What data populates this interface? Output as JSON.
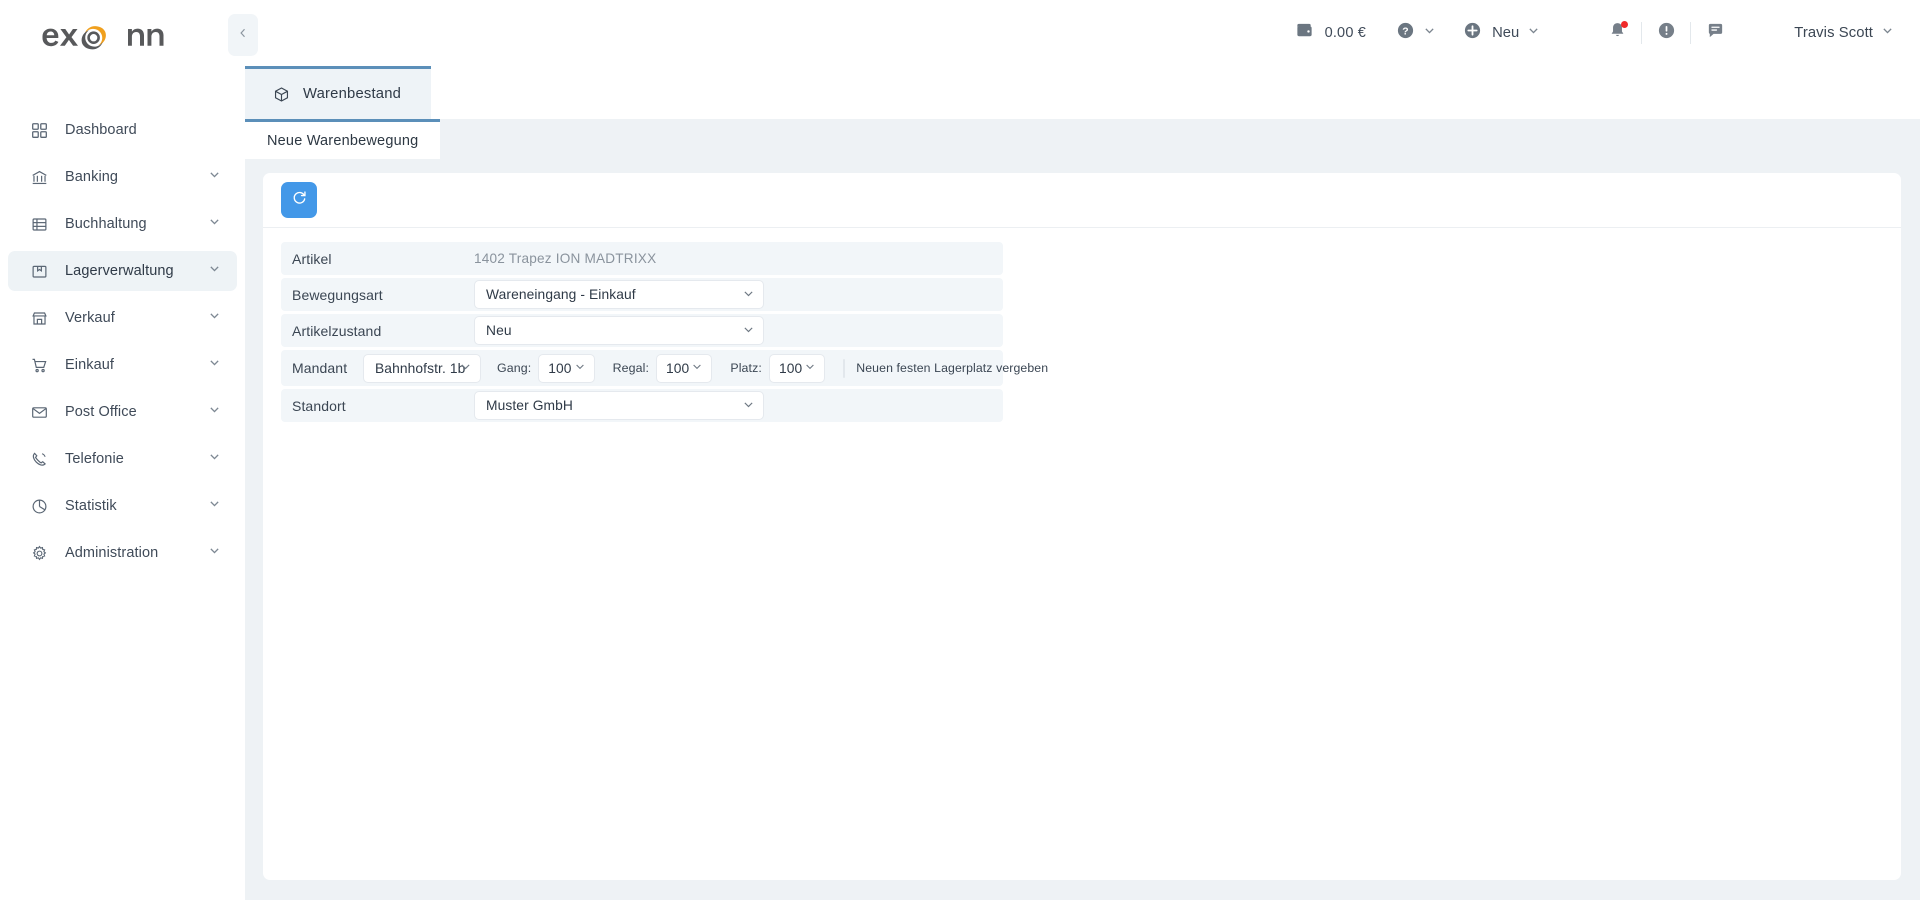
{
  "brand": {
    "name": "exonn",
    "logo_dark": "#58595b",
    "logo_accent": "#f0a01e"
  },
  "accent": {
    "tab_underline": "#5b8fb9",
    "primary_button": "#4398e8",
    "notification_dot": "#f02a2a"
  },
  "sidebar": {
    "collapse_icon": "chevron-left-icon",
    "items": [
      {
        "label": "Dashboard",
        "icon": "grid-icon",
        "expandable": false,
        "active": false
      },
      {
        "label": "Banking",
        "icon": "bank-icon",
        "expandable": true,
        "active": false
      },
      {
        "label": "Buchhaltung",
        "icon": "ledger-icon",
        "expandable": true,
        "active": false
      },
      {
        "label": "Lagerverwaltung",
        "icon": "warehouse-icon",
        "expandable": true,
        "active": true
      },
      {
        "label": "Verkauf",
        "icon": "store-icon",
        "expandable": true,
        "active": false
      },
      {
        "label": "Einkauf",
        "icon": "cart-icon",
        "expandable": true,
        "active": false
      },
      {
        "label": "Post Office",
        "icon": "envelope-icon",
        "expandable": true,
        "active": false
      },
      {
        "label": "Telefonie",
        "icon": "phone-icon",
        "expandable": true,
        "active": false
      },
      {
        "label": "Statistik",
        "icon": "pie-chart-icon",
        "expandable": true,
        "active": false
      },
      {
        "label": "Administration",
        "icon": "gear-icon",
        "expandable": true,
        "active": false
      }
    ]
  },
  "topbar": {
    "wallet_icon": "wallet-icon",
    "balance": "0.00 €",
    "help_icon": "question-circle-icon",
    "new_icon": "plus-circle-icon",
    "new_label": "Neu",
    "bell_icon": "bell-icon",
    "has_notification": true,
    "alert_icon": "exclamation-circle-icon",
    "messages_icon": "message-icon",
    "user_name": "Travis Scott",
    "user_chevron": "chevron-down-icon"
  },
  "tabs": {
    "primary": {
      "label": "Warenbestand",
      "icon": "cube-icon",
      "active": true
    },
    "sub": {
      "label": "Neue Warenbewegung",
      "active": true
    }
  },
  "toolbar": {
    "refresh_icon": "refresh-icon"
  },
  "form": {
    "rows": [
      {
        "label": "Artikel",
        "type": "static",
        "value": "1402 Trapez ION MADTRIXX"
      },
      {
        "label": "Bewegungsart",
        "type": "select",
        "value": "Wareneingang - Einkauf"
      },
      {
        "label": "Artikelzustand",
        "type": "select",
        "value": "Neu"
      },
      {
        "label": "Standort",
        "type": "select",
        "value": "Muster GmbH"
      }
    ],
    "mandant": {
      "label": "Mandant",
      "address_value": "Bahnhofstr. 1b",
      "gang_label": "Gang:",
      "gang_value": "100",
      "regal_label": "Regal:",
      "regal_value": "100",
      "platz_label": "Platz:",
      "platz_value": "100",
      "checkbox_label": "Neuen festen Lagerplatz vergeben",
      "checkbox_checked": false
    }
  }
}
